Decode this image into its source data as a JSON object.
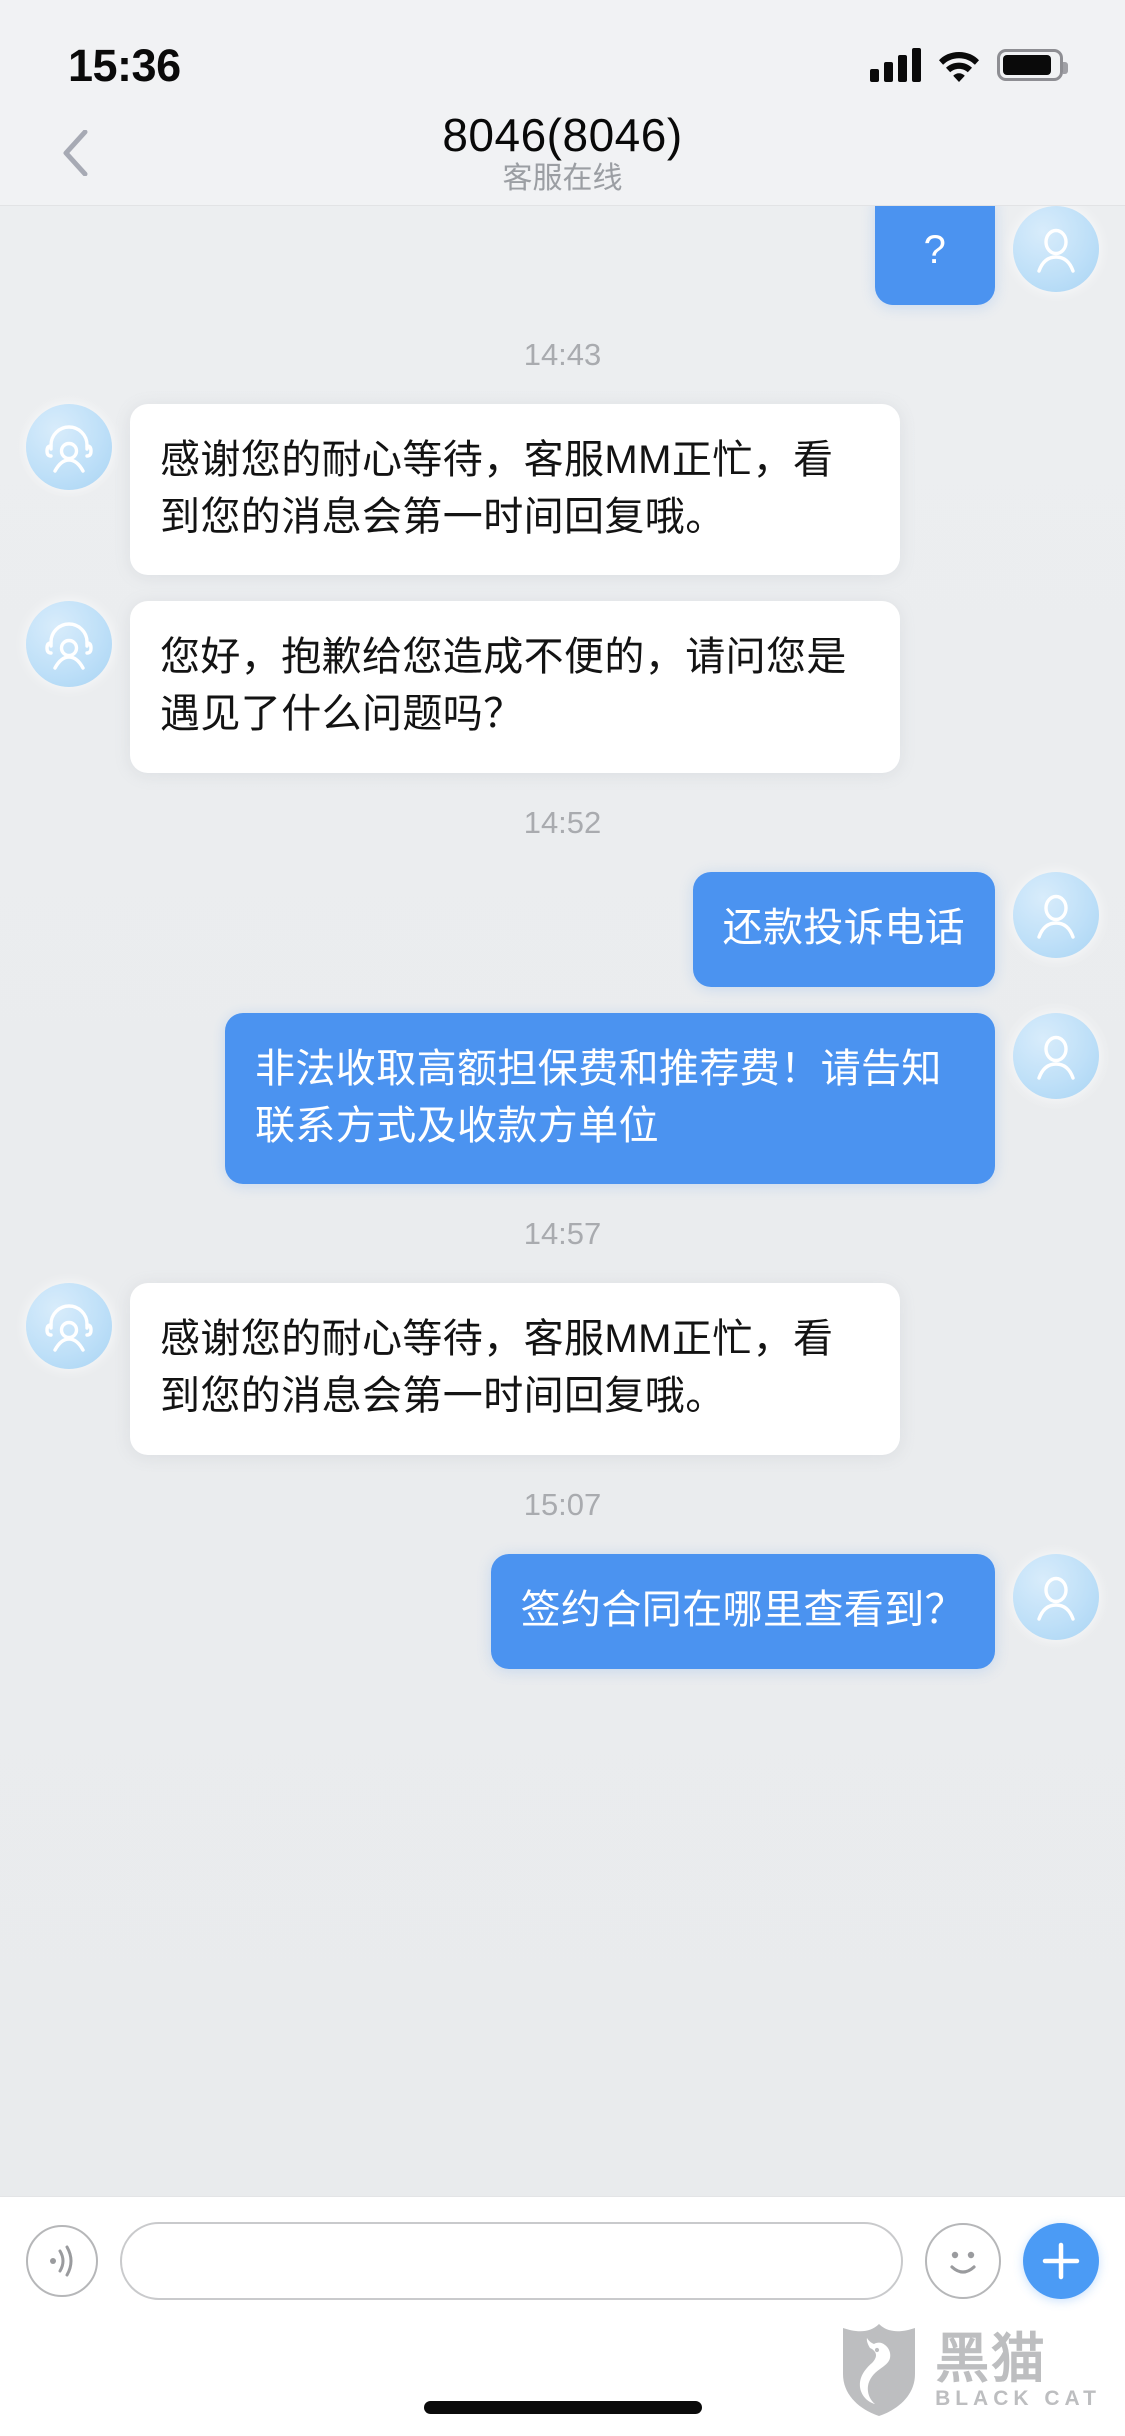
{
  "status_bar": {
    "time": "15:36",
    "signal_icon": "cellular-signal-icon",
    "wifi_icon": "wifi-icon",
    "battery_icon": "battery-icon"
  },
  "header": {
    "back_icon": "chevron-left-icon",
    "title": "8046(8046)",
    "subtitle": "客服在线"
  },
  "theme": {
    "user_bubble_color": "#4b93f0",
    "agent_bubble_color": "#ffffff",
    "page_background": "#eceef0",
    "accent_color": "#4b9bf5",
    "timestamp_color": "#a9abaf"
  },
  "chat": {
    "items": [
      {
        "kind": "message",
        "sender": "user",
        "text": "?",
        "partial": true
      },
      {
        "kind": "timestamp",
        "text": "14:43"
      },
      {
        "kind": "message",
        "sender": "agent",
        "text": "感谢您的耐心等待，客服MM正忙，看到您的消息会第一时间回复哦。"
      },
      {
        "kind": "message",
        "sender": "agent",
        "text": "您好，抱歉给您造成不便的，请问您是遇见了什么问题吗？"
      },
      {
        "kind": "timestamp",
        "text": "14:52"
      },
      {
        "kind": "message",
        "sender": "user",
        "text": "还款投诉电话"
      },
      {
        "kind": "message",
        "sender": "user",
        "text": "非法收取高额担保费和推荐费！请告知联系方式及收款方单位"
      },
      {
        "kind": "timestamp",
        "text": "14:57"
      },
      {
        "kind": "message",
        "sender": "agent",
        "text": "感谢您的耐心等待，客服MM正忙，看到您的消息会第一时间回复哦。"
      },
      {
        "kind": "timestamp",
        "text": "15:07"
      },
      {
        "kind": "message",
        "sender": "user",
        "text": "签约合同在哪里查看到？"
      }
    ]
  },
  "input_bar": {
    "voice_icon": "voice-wave-icon",
    "message_value": "",
    "message_placeholder": "",
    "emoji_icon": "smiley-face-icon",
    "add_icon": "plus-icon"
  },
  "watermark": {
    "logo_icon": "black-cat-shield-logo",
    "name_cn": "黑猫",
    "name_en": "BLACK CAT"
  }
}
